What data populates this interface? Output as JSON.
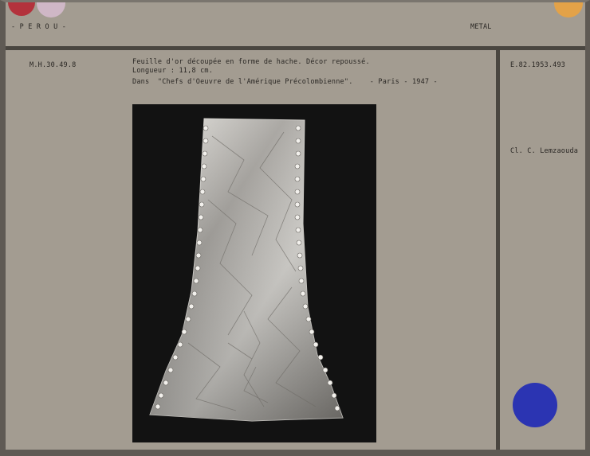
{
  "header": {
    "country": "- P E R O U -",
    "category": "METAL"
  },
  "record": {
    "inventory_number": "M.H.30.49.8",
    "description_line1": "Feuille d'or découpée en forme de hache. Décor repoussé.",
    "description_line2": "Longueur : 11,8 cm.",
    "publication": "Dans  \"Chefs d'Oeuvre de l'Amérique Précolombienne\".    - Paris - 1947 -",
    "photo_number": "E.82.1953.493",
    "photo_credit": "Cl. C. Lemzaouda"
  },
  "colors": {
    "card": "#a39c91",
    "dot_red": "#b3323c",
    "dot_pink": "#cfb7c6",
    "dot_orange": "#e3a248",
    "dot_blue": "#2b34b2",
    "photo_background": "#121212"
  }
}
